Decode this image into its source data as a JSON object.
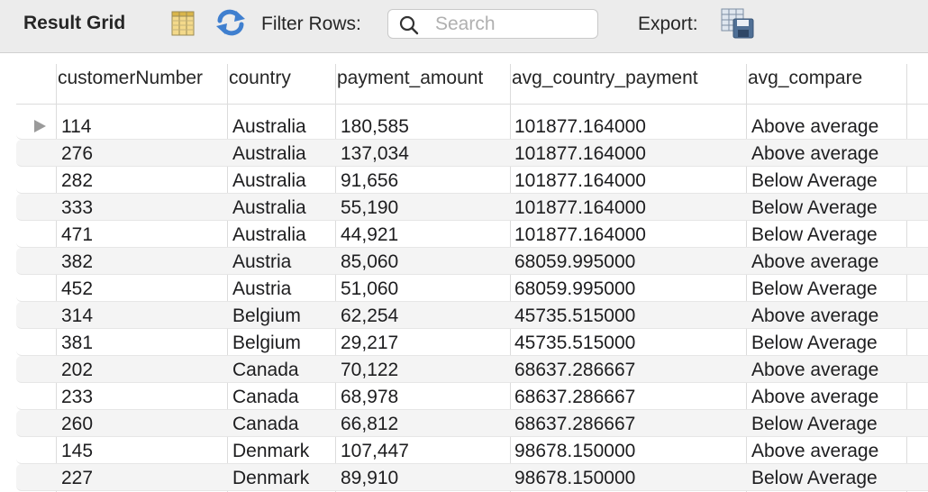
{
  "toolbar": {
    "title": "Result Grid",
    "filter_label": "Filter Rows:",
    "search_placeholder": "Search",
    "export_label": "Export:"
  },
  "icons": {
    "columns": "columns-icon",
    "refresh": "refresh-icon",
    "search": "search-icon",
    "export": "export-icon"
  },
  "colors": {
    "toolbar_bg": "#ececec",
    "row_alt_bg": "#f4f4f4",
    "refresh_blue": "#3f7fcf",
    "columns_yellow": "#e8c24a"
  },
  "grid": {
    "columns": [
      "customerNumber",
      "country",
      "payment_amount",
      "avg_country_payment",
      "avg_compare"
    ],
    "rows": [
      [
        "114",
        "Australia",
        "180,585",
        "101877.164000",
        "Above average"
      ],
      [
        "276",
        "Australia",
        "137,034",
        "101877.164000",
        "Above average"
      ],
      [
        "282",
        "Australia",
        "91,656",
        "101877.164000",
        "Below Average"
      ],
      [
        "333",
        "Australia",
        "55,190",
        "101877.164000",
        "Below Average"
      ],
      [
        "471",
        "Australia",
        "44,921",
        "101877.164000",
        "Below Average"
      ],
      [
        "382",
        "Austria",
        "85,060",
        "68059.995000",
        "Above average"
      ],
      [
        "452",
        "Austria",
        "51,060",
        "68059.995000",
        "Below Average"
      ],
      [
        "314",
        "Belgium",
        "62,254",
        "45735.515000",
        "Above average"
      ],
      [
        "381",
        "Belgium",
        "29,217",
        "45735.515000",
        "Below Average"
      ],
      [
        "202",
        "Canada",
        "70,122",
        "68637.286667",
        "Above average"
      ],
      [
        "233",
        "Canada",
        "68,978",
        "68637.286667",
        "Above average"
      ],
      [
        "260",
        "Canada",
        "66,812",
        "68637.286667",
        "Below Average"
      ],
      [
        "145",
        "Denmark",
        "107,447",
        "98678.150000",
        "Above average"
      ],
      [
        "227",
        "Denmark",
        "89,910",
        "98678.150000",
        "Below Average"
      ]
    ]
  }
}
